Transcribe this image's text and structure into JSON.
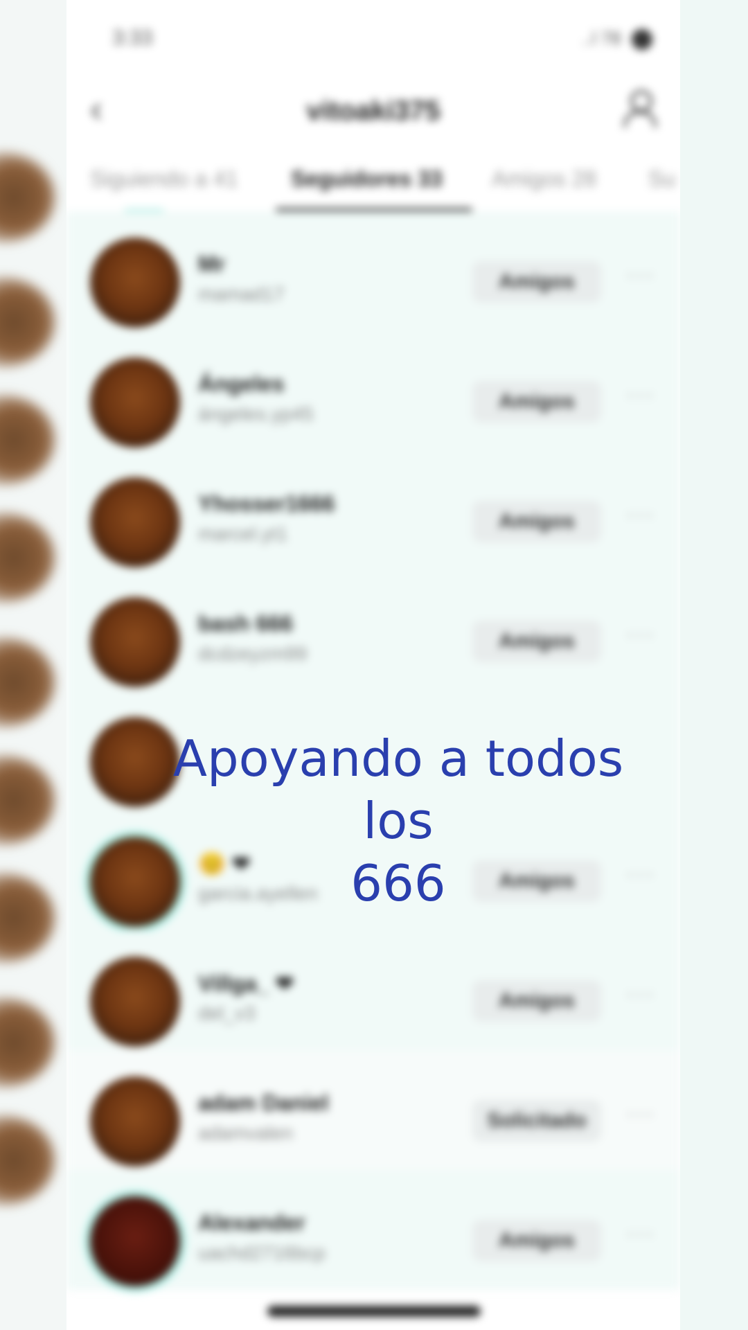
{
  "status_bar": {
    "time": "3:33",
    "signal": "..l",
    "battery": "78"
  },
  "header": {
    "back_icon": "chevron-left-icon",
    "title": "vitoaki375",
    "add_person_icon": "person-icon"
  },
  "tabs": [
    {
      "label": "Siguiendo a 41",
      "active": false
    },
    {
      "label": "Seguidores 33",
      "active": true
    },
    {
      "label": "Amigos 28",
      "active": false
    },
    {
      "label": "Su",
      "active": false
    }
  ],
  "rows": [
    {
      "name": "Mr",
      "handle": "mamad17",
      "button": "Amigos"
    },
    {
      "name": "Ángeles",
      "handle": "ángeles.yp45",
      "button": "Amigos"
    },
    {
      "name": "Yhosser1666",
      "handle": "marcel.yt1",
      "button": "Amigos"
    },
    {
      "name": "bash 666",
      "handle": "dcdzeyzm99",
      "button": "Amigos"
    },
    {
      "name": "",
      "handle": "",
      "button": ""
    },
    {
      "name": "😊 ❤",
      "handle": "garcia.ayellen",
      "button": "Amigos"
    },
    {
      "name": "Villga_ ❤",
      "handle": "del_v3",
      "button": "Amigos"
    },
    {
      "name": "adam Daniel",
      "handle": "adamvalen",
      "button": "Solicitado"
    },
    {
      "name": "Alexander",
      "handle": "uachd2716bcp",
      "button": "Amigos"
    }
  ],
  "row_more_label": "···",
  "caption": {
    "text": "Apoyando  a todos los\n666"
  },
  "colors": {
    "caption": "#2a3fae",
    "accent": "#a8f0e6"
  }
}
